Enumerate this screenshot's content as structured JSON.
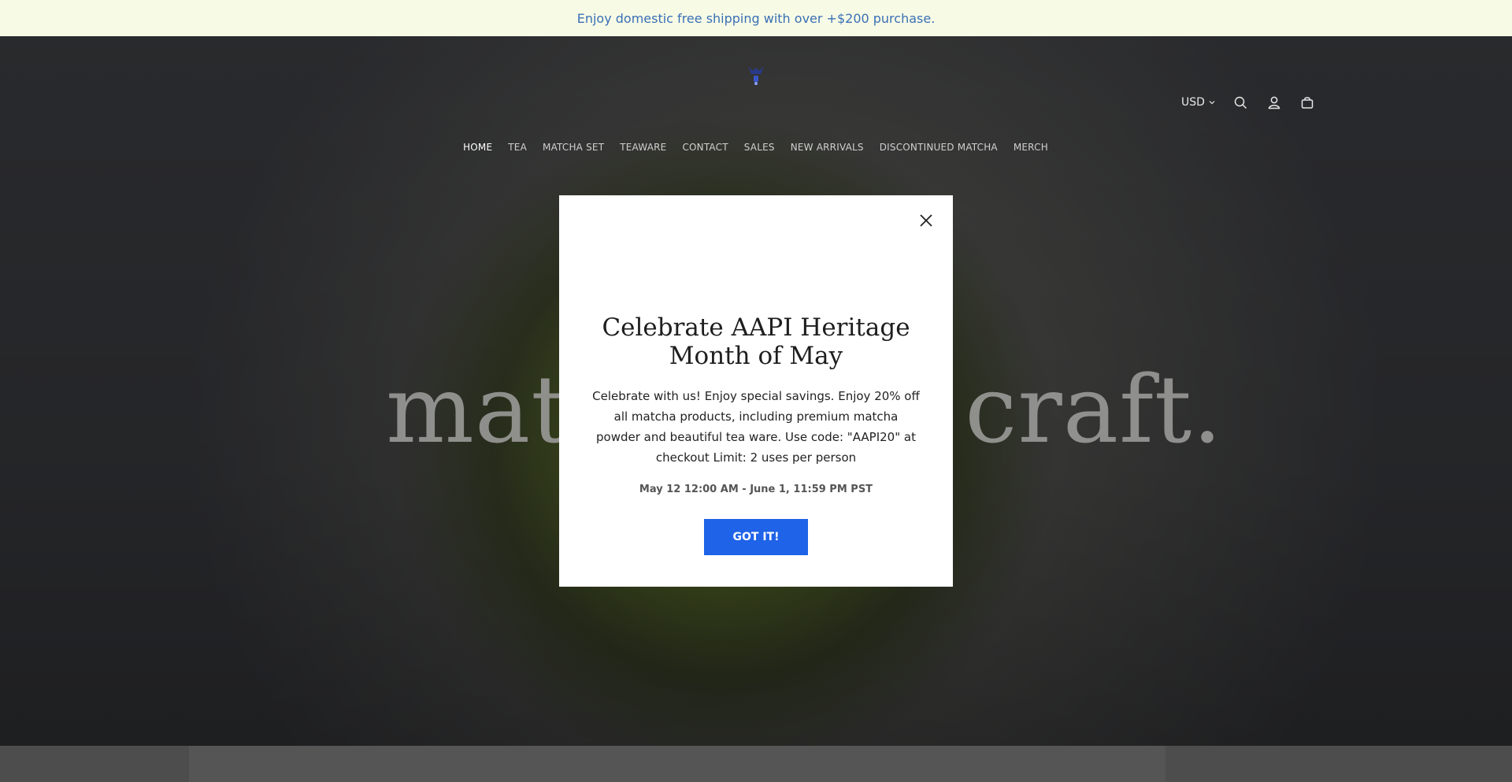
{
  "announcement": {
    "text": "Enjoy domestic free shipping with over +$200 purchase."
  },
  "header": {
    "currency": "USD",
    "nav": [
      {
        "label": "HOME",
        "active": true
      },
      {
        "label": "TEA"
      },
      {
        "label": "MATCHA SET"
      },
      {
        "label": "TEAWARE"
      },
      {
        "label": "CONTACT"
      },
      {
        "label": "SALES"
      },
      {
        "label": "NEW ARRIVALS"
      },
      {
        "label": "DISCONTINUED MATCHA"
      },
      {
        "label": "MERCH"
      }
    ],
    "icons": [
      "search-icon",
      "account-icon",
      "cart-icon"
    ]
  },
  "hero": {
    "headline": "matcha is a craft."
  },
  "modal": {
    "title": "Celebrate AAPI Heritage Month of May",
    "body": "Celebrate with us! Enjoy special savings. Enjoy 20% off all matcha products, including premium matcha powder and beautiful tea ware. Use code: \"AAPI20\" at checkout Limit: 2 uses per person",
    "dates": "May 12 12:00 AM - June 1, 11:59 PM PST",
    "button_label": "GOT IT!"
  },
  "colors": {
    "announcement_bg": "#f7fbe6",
    "announcement_text": "#3a6fb5",
    "button_bg": "#1f63e8"
  }
}
